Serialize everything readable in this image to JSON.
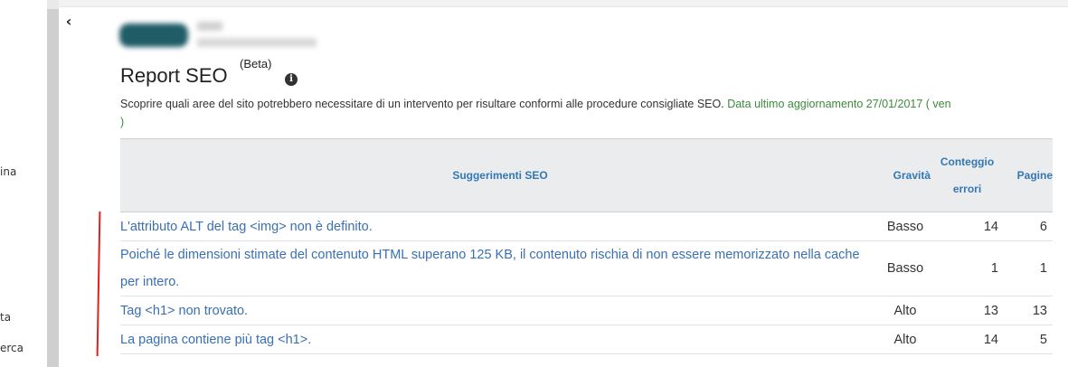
{
  "sidebar": {
    "items": [
      {
        "label": "ina"
      },
      {
        "label": "ta"
      },
      {
        "label": "erca"
      }
    ]
  },
  "header": {
    "title": "Report SEO",
    "beta": "(Beta)",
    "info_icon": "info-circle-icon",
    "collapse_icon": "chevron-left-icon"
  },
  "description": {
    "text": "Scoprire quali aree del sito potrebbero necessitare di un intervento per risultare conformi alle procedure consigliate SEO.",
    "updated": "Data ultimo aggiornamento 27/01/2017 ( ven",
    "updated_cont": ")"
  },
  "table": {
    "headers": {
      "suggestion": "Suggerimenti SEO",
      "severity": "Gravità",
      "errors_line1": "Conteggio",
      "errors_line2": "errori",
      "pages": "Pagine"
    },
    "rows": [
      {
        "suggestion": "L'attributo ALT del tag <img> non è definito.",
        "severity": "Basso",
        "errors": "14",
        "pages": "6"
      },
      {
        "suggestion": "Poiché le dimensioni stimate del contenuto HTML superano 125 KB, il contenuto rischia di non essere memorizzato nella cache per intero.",
        "severity": "Basso",
        "errors": "1",
        "pages": "1"
      },
      {
        "suggestion": "Tag <h1> non trovato.",
        "severity": "Alto",
        "errors": "13",
        "pages": "13"
      },
      {
        "suggestion": "La pagina contiene più tag <h1>.",
        "severity": "Alto",
        "errors": "14",
        "pages": "5"
      }
    ]
  },
  "colors": {
    "link": "#3a6fb0",
    "header_text": "#3377b5",
    "updated_text": "#3c8a3c",
    "marker": "#e02020"
  }
}
